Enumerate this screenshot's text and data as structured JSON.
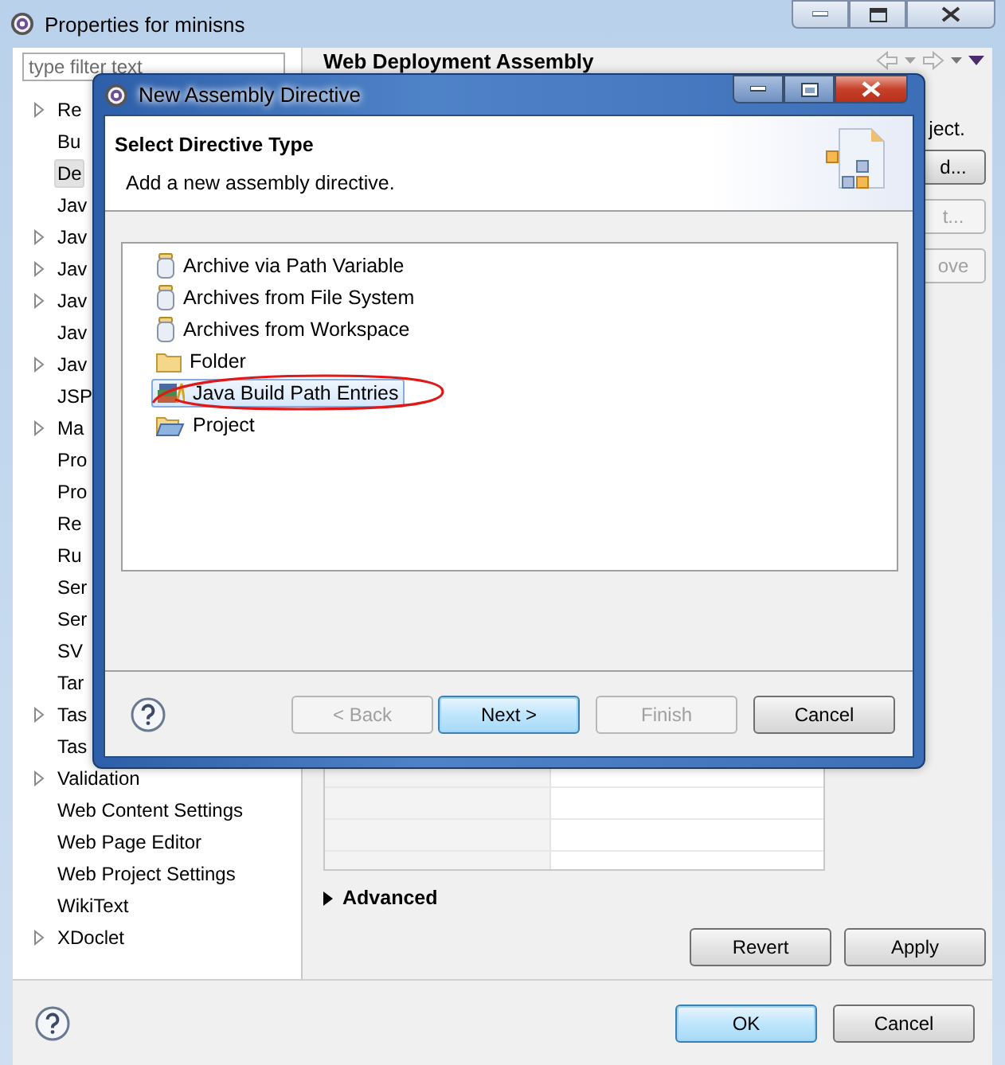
{
  "window": {
    "title": "Properties for minisns"
  },
  "filter": {
    "placeholder": "type filter text"
  },
  "tree": [
    {
      "label": "Re",
      "expandable": true,
      "selected": false
    },
    {
      "label": "Bu",
      "expandable": false,
      "selected": false
    },
    {
      "label": "De",
      "expandable": false,
      "selected": true
    },
    {
      "label": "Jav",
      "expandable": false,
      "selected": false
    },
    {
      "label": "Jav",
      "expandable": true,
      "selected": false
    },
    {
      "label": "Jav",
      "expandable": true,
      "selected": false
    },
    {
      "label": "Jav",
      "expandable": true,
      "selected": false
    },
    {
      "label": "Jav",
      "expandable": false,
      "selected": false
    },
    {
      "label": "Jav",
      "expandable": true,
      "selected": false
    },
    {
      "label": "JSP",
      "expandable": false,
      "selected": false
    },
    {
      "label": "Ma",
      "expandable": true,
      "selected": false
    },
    {
      "label": "Pro",
      "expandable": false,
      "selected": false
    },
    {
      "label": "Pro",
      "expandable": false,
      "selected": false
    },
    {
      "label": "Re",
      "expandable": false,
      "selected": false
    },
    {
      "label": "Ru",
      "expandable": false,
      "selected": false
    },
    {
      "label": "Ser",
      "expandable": false,
      "selected": false
    },
    {
      "label": "Ser",
      "expandable": false,
      "selected": false
    },
    {
      "label": "SV",
      "expandable": false,
      "selected": false
    },
    {
      "label": "Tar",
      "expandable": false,
      "selected": false
    },
    {
      "label": "Tas",
      "expandable": true,
      "selected": false
    },
    {
      "label": "Tas",
      "expandable": false,
      "selected": false
    },
    {
      "label": "Validation",
      "expandable": true,
      "selected": false
    },
    {
      "label": "Web Content Settings",
      "expandable": false,
      "selected": false
    },
    {
      "label": "Web Page Editor",
      "expandable": false,
      "selected": false
    },
    {
      "label": "Web Project Settings",
      "expandable": false,
      "selected": false
    },
    {
      "label": "WikiText",
      "expandable": false,
      "selected": false
    },
    {
      "label": "XDoclet",
      "expandable": true,
      "selected": false
    }
  ],
  "page": {
    "title": "Web Deployment Assembly",
    "description": "ject.",
    "side_buttons": [
      {
        "label": "d...",
        "disabled": false
      },
      {
        "label": "t...",
        "disabled": true
      },
      {
        "label": "ove",
        "disabled": true
      }
    ],
    "advanced": {
      "label": "Advanced",
      "expanded": false
    },
    "buttons": [
      {
        "label": "Revert"
      },
      {
        "label": "Apply"
      }
    ]
  },
  "footer_buttons": [
    {
      "label": "OK",
      "default": true
    },
    {
      "label": "Cancel",
      "default": false
    }
  ],
  "dialog": {
    "title": "New Assembly Directive",
    "header": {
      "title": "Select Directive Type",
      "message": "Add a new assembly directive."
    },
    "items": [
      {
        "label": "Archive via Path Variable",
        "kind": "jar",
        "selected": false
      },
      {
        "label": "Archives from File System",
        "kind": "jar",
        "selected": false
      },
      {
        "label": "Archives from Workspace",
        "kind": "jar",
        "selected": false
      },
      {
        "label": "Folder",
        "kind": "folder",
        "selected": false
      },
      {
        "label": "Java Build Path Entries",
        "kind": "library",
        "selected": true
      },
      {
        "label": "Project",
        "kind": "project",
        "selected": false
      }
    ],
    "buttons": [
      {
        "label": "< Back",
        "disabled": true,
        "default": false
      },
      {
        "label": "Next >",
        "disabled": false,
        "default": true
      },
      {
        "label": "Finish",
        "disabled": true,
        "default": false
      },
      {
        "label": "Cancel",
        "disabled": false,
        "default": false
      }
    ]
  }
}
